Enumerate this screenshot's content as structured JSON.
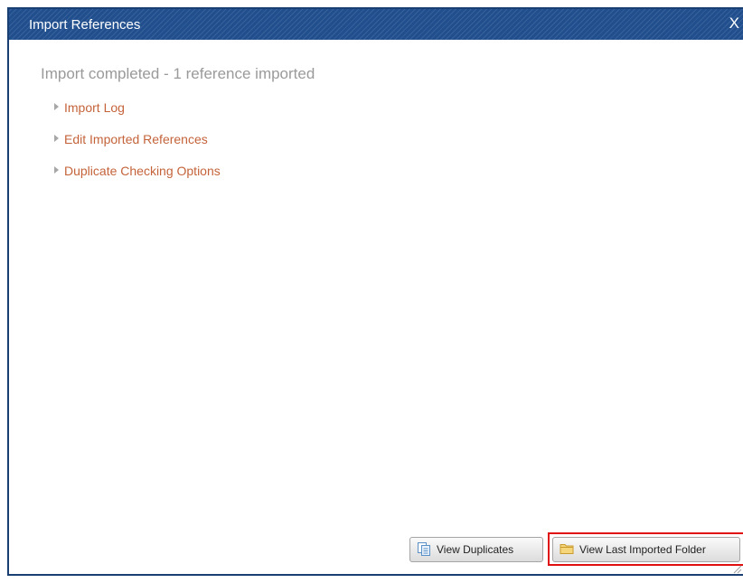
{
  "dialog": {
    "title": "Import References",
    "close_label": "X"
  },
  "status_message": "Import completed - 1 reference imported",
  "links": [
    {
      "label": "Import Log"
    },
    {
      "label": "Edit Imported References"
    },
    {
      "label": "Duplicate Checking Options"
    }
  ],
  "buttons": {
    "view_duplicates": "View Duplicates",
    "view_last_imported_folder": "View Last Imported Folder"
  },
  "icons": {
    "duplicates": "copy-documents-icon",
    "folder": "folder-icon",
    "link_marker": "triangle-right-icon"
  },
  "colors": {
    "titlebar": "#214f8e",
    "link": "#c4633a",
    "status_text": "#9a9a9a",
    "highlight": "#e01010"
  }
}
